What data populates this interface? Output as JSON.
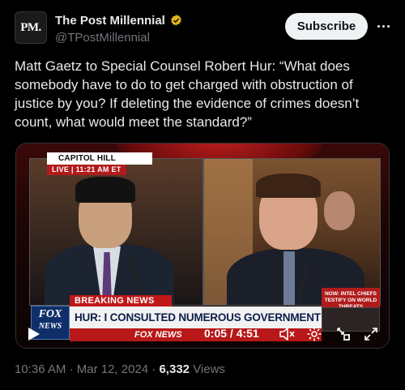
{
  "account": {
    "avatar_text": "PM.",
    "name": "The Post Millennial",
    "handle": "@TPostMillennial",
    "verified_color": "#e2b719"
  },
  "actions": {
    "subscribe_label": "Subscribe"
  },
  "tweet": {
    "text": "Matt Gaetz to Special Counsel Robert Hur: “What does somebody have to do to get charged with obstruction of justice by you? If deleting the evidence of crimes doesn’t count, what would meet the standard?”"
  },
  "video": {
    "location": "CAPITOL HILL",
    "live_label": "LIVE | 11:21 AM ET",
    "breaking_label": "BREAKING NEWS",
    "headline": "HUR: I CONSULTED NUMEROUS GOVERNMENT AGENCIES",
    "network_strip": "FOX NEWS",
    "logo_top": "FOX",
    "logo_bottom": "NEWS",
    "side_box": "NOW: INTEL CHIEFS TESTIFY ON WORLD THREATS",
    "time_display": "0:05 / 4:51"
  },
  "meta": {
    "time": "10:36 AM",
    "separator": "·",
    "date": "Mar 12, 2024",
    "views_count": "6,332",
    "views_label": "Views"
  },
  "colors": {
    "background": "#000000",
    "text": "#e7e9ea",
    "muted": "#71767b",
    "fox_red": "#c01818",
    "fox_blue": "#0f2f6b"
  }
}
